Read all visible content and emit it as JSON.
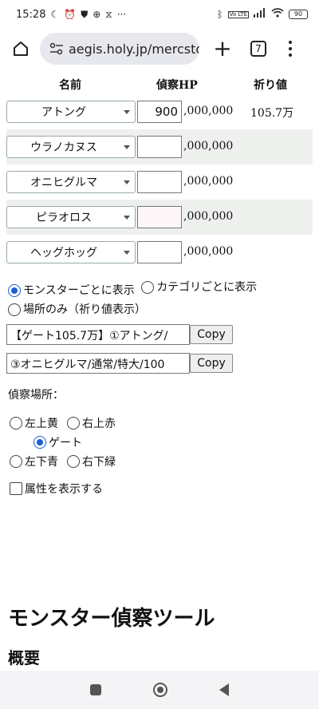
{
  "status_bar": {
    "time": "15:28",
    "icons_left": [
      "moon-icon",
      "alarm-icon",
      "shield-icon",
      "compass-icon",
      "app-icon",
      "more-icon"
    ],
    "icons_right": [
      "bluetooth-icon",
      "volte-icon",
      "signal-icon",
      "wifi-icon"
    ],
    "battery": "90",
    "volte_label": "Vo LTE"
  },
  "browser": {
    "url": "aegis.holy.jp/mercstor",
    "tab_count": "7"
  },
  "table": {
    "headers": {
      "name": "名前",
      "hp": "偵察HP",
      "pray": "祈り値"
    },
    "suffix": ",000,000",
    "rows": [
      {
        "monster": "アトング",
        "hp_value": "900",
        "pray": "105.7万"
      },
      {
        "monster": "ウラノカヌス",
        "hp_value": "",
        "pray": ""
      },
      {
        "monster": "オニヒグルマ",
        "hp_value": "",
        "pray": ""
      },
      {
        "monster": "ピラオロス",
        "hp_value": "",
        "pray": ""
      },
      {
        "monster": "ヘッグホッグ",
        "hp_value": "",
        "pray": ""
      }
    ]
  },
  "display_mode": {
    "options": [
      "モンスターごとに表示",
      "カテゴリごとに表示",
      "場所のみ（祈り値表示）"
    ],
    "selected": "モンスターごとに表示"
  },
  "outputs": [
    {
      "text": "【ゲート105.7万】①アトング/",
      "copy_label": "Copy"
    },
    {
      "text": "③オニヒグルマ/通常/特大/100",
      "copy_label": "Copy"
    }
  ],
  "location": {
    "label": "偵察場所：",
    "options": [
      "左上黄",
      "右上赤",
      "ゲート",
      "左下青",
      "右下緑"
    ],
    "selected": "ゲート"
  },
  "attribute_checkbox": {
    "label": "属性を表示する",
    "checked": false
  },
  "headings": {
    "title": "モンスター偵察ツール",
    "overview": "概要"
  }
}
